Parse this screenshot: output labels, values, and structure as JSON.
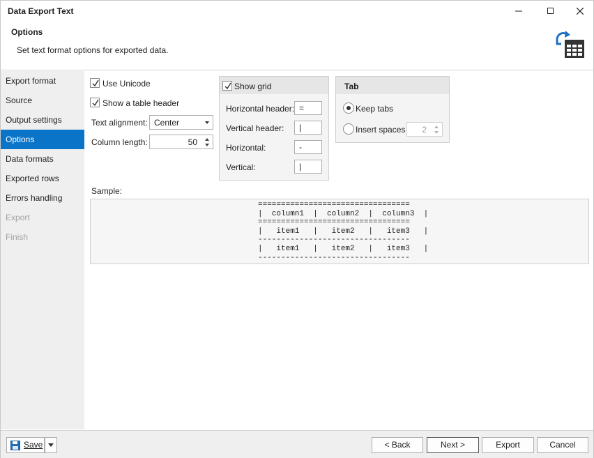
{
  "window": {
    "title": "Data Export Text"
  },
  "header": {
    "title": "Options",
    "description": "Set text format options for exported data.",
    "icon": "table-export-icon"
  },
  "sidebar": {
    "items": [
      {
        "label": "Export format",
        "state": "normal"
      },
      {
        "label": "Source",
        "state": "normal"
      },
      {
        "label": "Output settings",
        "state": "normal"
      },
      {
        "label": "Options",
        "state": "active"
      },
      {
        "label": "Data formats",
        "state": "normal"
      },
      {
        "label": "Exported rows",
        "state": "normal"
      },
      {
        "label": "Errors handling",
        "state": "normal"
      },
      {
        "label": "Export",
        "state": "disabled"
      },
      {
        "label": "Finish",
        "state": "disabled"
      }
    ]
  },
  "options": {
    "use_unicode": {
      "label": "Use Unicode",
      "checked": true
    },
    "show_table_header": {
      "label": "Show a table header",
      "checked": true
    },
    "text_alignment": {
      "label": "Text alignment:",
      "value": "Center"
    },
    "column_length": {
      "label": "Column length:",
      "value": "50"
    }
  },
  "grid": {
    "show_grid": {
      "label": "Show grid",
      "checked": true
    },
    "horizontal_header": {
      "label": "Horizontal header:",
      "value": "="
    },
    "vertical_header": {
      "label": "Vertical header:",
      "value": "|"
    },
    "horizontal": {
      "label": "Horizontal:",
      "value": "-"
    },
    "vertical": {
      "label": "Vertical:",
      "value": "|"
    }
  },
  "tab": {
    "title": "Tab",
    "keep_tabs": {
      "label": "Keep tabs",
      "selected": true
    },
    "insert_spaces": {
      "label": "Insert spaces",
      "selected": false,
      "value": "2"
    }
  },
  "sample": {
    "label": "Sample:",
    "text": "=================================\n|  column1  |  column2  |  column3  |\n=================================\n|   item1   |   item2   |   item3   |\n---------------------------------\n|   item1   |   item2   |   item3   |\n---------------------------------"
  },
  "footer": {
    "save": "Save",
    "back": "< Back",
    "next": "Next >",
    "export": "Export",
    "cancel": "Cancel"
  },
  "colors": {
    "accent": "#0a74c9",
    "sidebar_bg": "#efefef",
    "group_bg": "#f4f4f4"
  }
}
